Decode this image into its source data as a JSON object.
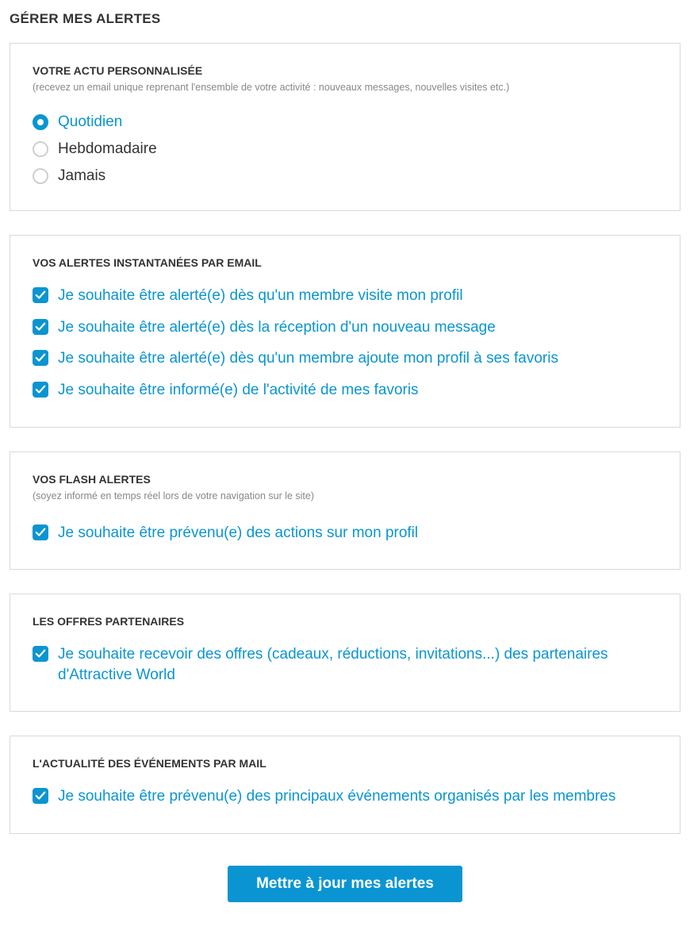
{
  "page": {
    "title": "GÉRER MES ALERTES"
  },
  "sections": {
    "actu": {
      "title": "VOTRE ACTU PERSONNALISÉE",
      "subtitle": "(recevez un email unique reprenant l'ensemble de votre activité : nouveaux messages, nouvelles visites etc.)",
      "options": {
        "quotidien": {
          "label": "Quotidien",
          "selected": true
        },
        "hebdo": {
          "label": "Hebdomadaire",
          "selected": false
        },
        "jamais": {
          "label": "Jamais",
          "selected": false
        }
      }
    },
    "instant": {
      "title": "VOS ALERTES INSTANTANÉES PAR EMAIL",
      "items": {
        "visite": {
          "label": "Je souhaite être alerté(e) dès qu'un membre visite mon profil",
          "checked": true
        },
        "message": {
          "label": "Je souhaite être alerté(e) dès la réception d'un nouveau message",
          "checked": true
        },
        "favoris": {
          "label": "Je souhaite être alerté(e) dès qu'un membre ajoute mon profil à ses favoris",
          "checked": true
        },
        "activite": {
          "label": "Je souhaite être informé(e) de l'activité de mes favoris",
          "checked": true
        }
      }
    },
    "flash": {
      "title": "VOS FLASH ALERTES",
      "subtitle": "(soyez informé en temps réel lors de votre navigation sur le site)",
      "items": {
        "actions": {
          "label": "Je souhaite être prévenu(e) des actions sur mon profil",
          "checked": true
        }
      }
    },
    "partenaires": {
      "title": "LES OFFRES PARTENAIRES",
      "items": {
        "offres": {
          "label": "Je souhaite recevoir des offres (cadeaux, réductions, invitations...) des partenaires d'Attractive World",
          "checked": true
        }
      }
    },
    "evenements": {
      "title": "L'ACTUALITÉ DES ÉVÉNEMENTS PAR MAIL",
      "items": {
        "events": {
          "label": "Je souhaite être prévenu(e) des principaux événements organisés par les membres",
          "checked": true
        }
      }
    }
  },
  "actions": {
    "submit": "Mettre à jour mes alertes"
  },
  "colors": {
    "accent": "#0a95d2"
  }
}
